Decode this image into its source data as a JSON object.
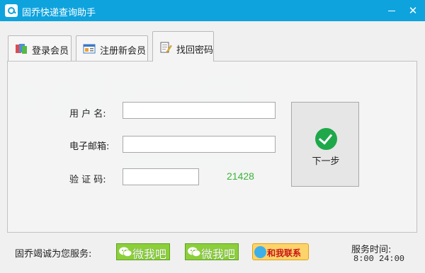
{
  "window": {
    "title": "固乔快递查询助手",
    "minimize_symbol": "—",
    "close_symbol": "✕"
  },
  "tabs": [
    {
      "label": "登录会员",
      "icon": "members-icon",
      "active": false
    },
    {
      "label": "注册新会员",
      "icon": "register-card-icon",
      "active": false
    },
    {
      "label": "找回密码",
      "icon": "notepad-pencil-icon",
      "active": true
    }
  ],
  "form": {
    "username_label": "用 户 名:",
    "username_value": "",
    "email_label": "电子邮箱:",
    "email_value": "",
    "captcha_label": "验 证 码:",
    "captcha_value": "",
    "captcha_code": "21428"
  },
  "next_button": {
    "label": "下一步",
    "icon": "green-check-icon"
  },
  "footer": {
    "service_label": "固乔竭诚为您服务:",
    "wechat_label": "微我吧",
    "qq_label": "和我联系",
    "hours_label": "服务时间:",
    "hours_value": "8:00 24:00"
  },
  "colors": {
    "titlebar": "#0fa3de",
    "captcha_code": "#39b539",
    "check": "#1fa84a",
    "wechat": "#8ccf3a",
    "qq": "#fdd36b"
  }
}
